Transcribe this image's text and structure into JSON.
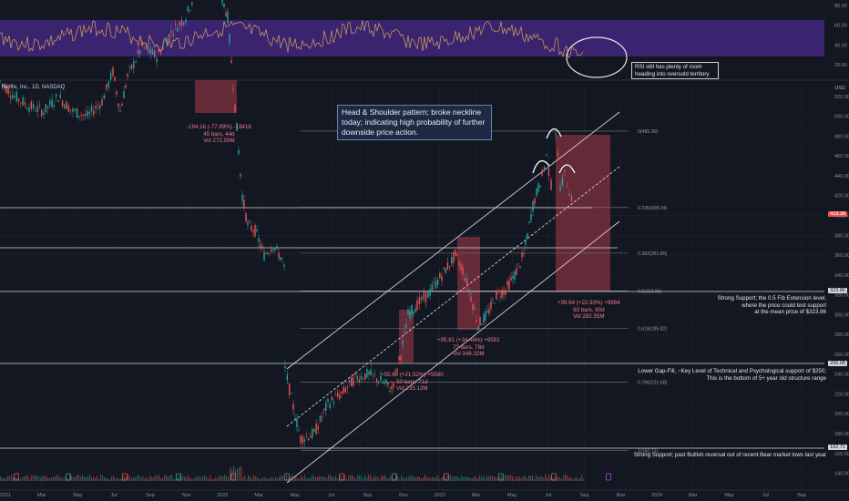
{
  "symbol_label": "Netflix, Inc., 1D, NASDAQ",
  "currency_label": "USD",
  "last_price_tag": "413.38",
  "colors": {
    "background": "#131722",
    "rsi_band": "#5b2fb0",
    "up": "#26a69a",
    "down": "#ef5350",
    "rsi_line": "#d4a25a",
    "channel": "#e6e6e6",
    "box": "#a83a4a"
  },
  "annotations": {
    "hs_pattern": "Head & Shoulder pattern; broke neckline today; indicating high probability of further downside price action.",
    "rsi_note": "RSI still has plenty of room heading into oversold territory",
    "strong_support": [
      "Strong Support; the 0.5 Fib Extension level,",
      "where the price could test support",
      "at the mean price of $323.86"
    ],
    "lower_gap": [
      "Lower Gap-Fill, ~Key Level of Technical and Psychological support of $250;",
      "This is the bottom of 5+ year old structure range"
    ],
    "strong_support_low": "Strong Support; past Bullish reversal out of recent Bear market lows last year"
  },
  "measure_labels": {
    "m1": [
      "-194.16 (-77.89%) -19416",
      "45 bars, 44d",
      "Vol 272.59M"
    ],
    "m2": [
      "+95.81 (+34.46%) +9581",
      "73 bars, 78d",
      "Vol 348.32M"
    ],
    "m3": [
      "+99.64 (+22.93%) +9964",
      "63 bars, 90d",
      "Vol 282.55M"
    ],
    "m4": [
      "+55.80 (+21.52%) +5580",
      "50 bars, 71d",
      "Vol 233.13M"
    ]
  },
  "price_axis_tags": [
    "323.86",
    "250.08",
    "162.71"
  ],
  "chart_data": {
    "type": "candlestick",
    "title": "Netflix, Inc., 1D, NASDAQ",
    "x_ticks": [
      "2021",
      "Mar",
      "May",
      "Jul",
      "Sep",
      "Nov",
      "2022",
      "Mar",
      "May",
      "Jul",
      "Sep",
      "Nov",
      "2023",
      "Mar",
      "May",
      "Jul",
      "Sep",
      "Nov",
      "2024",
      "Mar",
      "May",
      "Jul",
      "Sep"
    ],
    "y_ticks": [
      520,
      500,
      480,
      460,
      440,
      420,
      400,
      380,
      360,
      340,
      320,
      300,
      280,
      260,
      240,
      220,
      200,
      180,
      160,
      140
    ],
    "ylim": [
      135,
      530
    ],
    "rsi_ticks": [
      80,
      60,
      40,
      20
    ],
    "rsi_band": [
      30,
      70
    ],
    "fib_levels": [
      {
        "ratio": "0(485.00)",
        "price": 485
      },
      {
        "ratio": "0.236(408.04)",
        "price": 408
      },
      {
        "ratio": "0.382(361.89)",
        "price": 362
      },
      {
        "ratio": "0.5(323.86)",
        "price": 324
      },
      {
        "ratio": "0.618(285.82)",
        "price": 286
      },
      {
        "ratio": "0.786(231.68)",
        "price": 232
      },
      {
        "ratio": "1(162.71)",
        "price": 163
      }
    ],
    "price_path": [
      [
        0,
        535
      ],
      [
        16,
        520
      ],
      [
        32,
        510
      ],
      [
        48,
        505
      ],
      [
        64,
        520
      ],
      [
        80,
        505
      ],
      [
        96,
        500
      ],
      [
        112,
        515
      ],
      [
        124,
        545
      ],
      [
        132,
        505
      ],
      [
        140,
        540
      ],
      [
        156,
        570
      ],
      [
        172,
        560
      ],
      [
        188,
        585
      ],
      [
        204,
        600
      ],
      [
        220,
        640
      ],
      [
        232,
        655
      ],
      [
        240,
        630
      ],
      [
        250,
        600
      ],
      [
        258,
        510
      ],
      [
        262,
        465
      ],
      [
        266,
        420
      ],
      [
        268,
        410
      ],
      [
        272,
        390
      ],
      [
        280,
        385
      ],
      [
        290,
        360
      ],
      [
        300,
        370
      ],
      [
        310,
        355
      ],
      [
        312,
        346
      ],
      [
        313,
        245
      ],
      [
        320,
        215
      ],
      [
        330,
        175
      ],
      [
        345,
        180
      ],
      [
        360,
        210
      ],
      [
        375,
        220
      ],
      [
        390,
        236
      ],
      [
        405,
        240
      ],
      [
        420,
        232
      ],
      [
        430,
        225
      ],
      [
        440,
        260
      ],
      [
        448,
        300
      ],
      [
        458,
        310
      ],
      [
        470,
        320
      ],
      [
        485,
        340
      ],
      [
        500,
        360
      ],
      [
        508,
        345
      ],
      [
        515,
        325
      ],
      [
        525,
        290
      ],
      [
        535,
        300
      ],
      [
        545,
        320
      ],
      [
        555,
        325
      ],
      [
        565,
        340
      ],
      [
        575,
        360
      ],
      [
        585,
        410
      ],
      [
        595,
        440
      ],
      [
        600,
        460
      ],
      [
        605,
        430
      ],
      [
        610,
        485
      ],
      [
        615,
        430
      ],
      [
        620,
        440
      ],
      [
        625,
        425
      ],
      [
        630,
        413
      ]
    ]
  }
}
